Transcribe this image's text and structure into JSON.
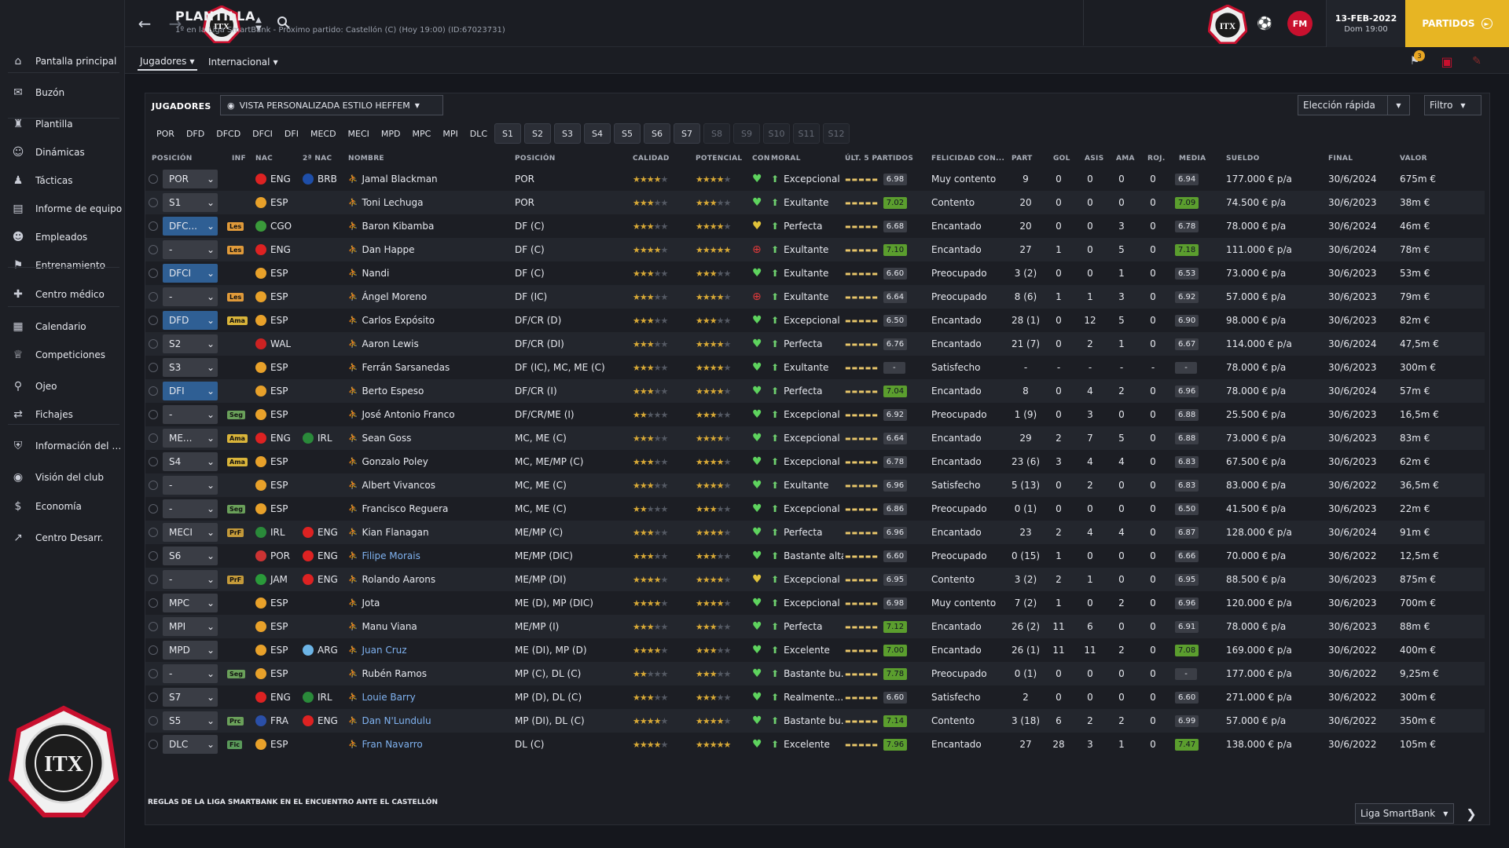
{
  "header": {
    "title": "PLANTILLA",
    "subtitle": "1º en la Liga SmartBank - Próximo partido: Castellón (C)  (Hoy 19:00) (ID:67023731)",
    "date": "13-FEB-2022",
    "date_sub": "Dom 19:00",
    "partidos": "PARTIDOS",
    "notif_count": "3",
    "fm_logo": "FM"
  },
  "sidebar": {
    "items": [
      {
        "label": "Pantalla principal",
        "icon": "home-icon"
      },
      {
        "label": "Buzón",
        "icon": "inbox-icon"
      },
      {
        "label": "Plantilla",
        "icon": "shirt-icon"
      },
      {
        "label": "Dinámicas",
        "icon": "people-icon"
      },
      {
        "label": "Tácticas",
        "icon": "tactics-icon"
      },
      {
        "label": "Informe de equipo",
        "icon": "report-icon"
      },
      {
        "label": "Empleados",
        "icon": "staff-icon"
      },
      {
        "label": "Entrenamiento",
        "icon": "training-icon"
      },
      {
        "label": "Centro médico",
        "icon": "medical-icon"
      },
      {
        "label": "Calendario",
        "icon": "calendar-icon"
      },
      {
        "label": "Competiciones",
        "icon": "trophy-icon"
      },
      {
        "label": "Ojeo",
        "icon": "scout-icon"
      },
      {
        "label": "Fichajes",
        "icon": "transfers-icon"
      },
      {
        "label": "Información del club",
        "icon": "shield-icon"
      },
      {
        "label": "Visión del club",
        "icon": "vision-icon"
      },
      {
        "label": "Economía",
        "icon": "money-icon"
      },
      {
        "label": "Centro Desarr.",
        "icon": "development-icon"
      }
    ]
  },
  "subtabs": [
    "Jugadores",
    "Internacional"
  ],
  "panel": {
    "title": "JUGADORES",
    "view": "VISTA PERSONALIZADA ESTILO HEFFEM",
    "quick": "Elección rápida",
    "filter": "Filtro",
    "footer_note": "REGLAS DE LA LIGA SMARTBANK EN EL ENCUENTRO ANTE EL CASTELLÓN",
    "league": "Liga SmartBank"
  },
  "pos_tabs": [
    "POR",
    "DFD",
    "DFCD",
    "DFCI",
    "DFI",
    "MECD",
    "MECI",
    "MPD",
    "MPC",
    "MPI",
    "DLC"
  ],
  "set_tabs": [
    {
      "label": "S1",
      "active": true
    },
    {
      "label": "S2",
      "active": true
    },
    {
      "label": "S3",
      "active": true
    },
    {
      "label": "S4",
      "active": true
    },
    {
      "label": "S5",
      "active": true
    },
    {
      "label": "S6",
      "active": true
    },
    {
      "label": "S7",
      "active": true
    },
    {
      "label": "S8",
      "active": false
    },
    {
      "label": "S9",
      "active": false
    },
    {
      "label": "S10",
      "active": false
    },
    {
      "label": "S11",
      "active": false
    },
    {
      "label": "S12",
      "active": false
    }
  ],
  "columns": [
    "POSICIÓN",
    "INF",
    "NAC",
    "2ª NAC",
    "NOMBRE",
    "POSICIÓN",
    "CALIDAD",
    "POTENCIAL",
    "CON",
    "MORAL",
    "ÚLT. 5 PARTIDOS",
    "FELICIDAD CON...",
    "PART",
    "GOL",
    "ASIS",
    "AMA",
    "ROJ.",
    "MEDIA",
    "SUELDO",
    "FINAL",
    "VALOR"
  ],
  "players": [
    {
      "sel": "POR",
      "inf": "",
      "nac": "ENG",
      "nac2": "BRB",
      "name": "Jamal Blackman",
      "pos": "POR",
      "cal": 3.5,
      "pot": 3.5,
      "con": "heart",
      "moral": "Excepcional",
      "l5": "6.98",
      "fel": "Muy contento",
      "part": "9",
      "gol": "0",
      "asis": "0",
      "ama": "0",
      "roj": "0",
      "media": "6.94",
      "sueldo": "177.000 € p/a",
      "final": "30/6/2024",
      "valor": "675m €",
      "link": false
    },
    {
      "sel": "S1",
      "inf": "",
      "nac": "ESP",
      "nac2": "",
      "name": "Toni Lechuga",
      "pos": "POR",
      "cal": 2.5,
      "pot": 2.5,
      "con": "heart",
      "moral": "Exultante",
      "l5": "7.02",
      "fel": "Contento",
      "part": "20",
      "gol": "0",
      "asis": "0",
      "ama": "0",
      "roj": "0",
      "media": "7.09",
      "sueldo": "74.500 € p/a",
      "final": "30/6/2023",
      "valor": "38m €",
      "link": false
    },
    {
      "sel": "DFC...",
      "inf": "Les",
      "nac": "CGO",
      "nac2": "",
      "name": "Baron Kibamba",
      "pos": "DF (C)",
      "cal": 3,
      "pot": 4,
      "con": "heart-y",
      "moral": "Perfecta",
      "l5": "6.68",
      "fel": "Encantado",
      "part": "20",
      "gol": "0",
      "asis": "0",
      "ama": "3",
      "roj": "0",
      "media": "6.78",
      "sueldo": "78.000 € p/a",
      "final": "30/6/2024",
      "valor": "46m €",
      "link": false
    },
    {
      "sel": "-",
      "inf": "Les",
      "nac": "ENG",
      "nac2": "",
      "name": "Dan Happe",
      "pos": "DF (C)",
      "cal": 3.5,
      "pot": 4.5,
      "con": "cross",
      "moral": "Exultante",
      "l5": "7.10",
      "fel": "Encantado",
      "part": "27",
      "gol": "1",
      "asis": "0",
      "ama": "5",
      "roj": "0",
      "media": "7.18",
      "sueldo": "111.000 € p/a",
      "final": "30/6/2024",
      "valor": "78m €",
      "link": false
    },
    {
      "sel": "DFCI",
      "inf": "",
      "nac": "ESP",
      "nac2": "",
      "name": "Nandi",
      "pos": "DF (C)",
      "cal": 2.5,
      "pot": 2.5,
      "con": "heart",
      "moral": "Exultante",
      "l5": "6.60",
      "fel": "Preocupado",
      "part": "3 (2)",
      "gol": "0",
      "asis": "0",
      "ama": "1",
      "roj": "0",
      "media": "6.53",
      "sueldo": "73.000 € p/a",
      "final": "30/6/2023",
      "valor": "53m €",
      "link": false
    },
    {
      "sel": "-",
      "inf": "Les",
      "nac": "ESP",
      "nac2": "",
      "name": "Ángel Moreno",
      "pos": "DF (IC)",
      "cal": 2.5,
      "pot": 3.5,
      "con": "cross",
      "moral": "Exultante",
      "l5": "6.64",
      "fel": "Preocupado",
      "part": "8 (6)",
      "gol": "1",
      "asis": "1",
      "ama": "3",
      "roj": "0",
      "media": "6.92",
      "sueldo": "57.000 € p/a",
      "final": "30/6/2023",
      "valor": "79m €",
      "link": false
    },
    {
      "sel": "DFD",
      "inf": "Ama",
      "nac": "ESP",
      "nac2": "",
      "name": "Carlos Expósito",
      "pos": "DF/CR (D)",
      "cal": 2.5,
      "pot": 2.5,
      "con": "heart",
      "moral": "Excepcional",
      "l5": "6.50",
      "fel": "Encantado",
      "part": "28 (1)",
      "gol": "0",
      "asis": "12",
      "ama": "5",
      "roj": "0",
      "media": "6.90",
      "sueldo": "98.000 € p/a",
      "final": "30/6/2023",
      "valor": "82m €",
      "link": false
    },
    {
      "sel": "S2",
      "inf": "",
      "nac": "WAL",
      "nac2": "",
      "name": "Aaron Lewis",
      "pos": "DF/CR (DI)",
      "cal": 2.5,
      "pot": 3.5,
      "con": "heart",
      "moral": "Perfecta",
      "l5": "6.76",
      "fel": "Encantado",
      "part": "21 (7)",
      "gol": "0",
      "asis": "2",
      "ama": "1",
      "roj": "0",
      "media": "6.67",
      "sueldo": "114.000 € p/a",
      "final": "30/6/2024",
      "valor": "47,5m €",
      "link": false
    },
    {
      "sel": "S3",
      "inf": "",
      "nac": "ESP",
      "nac2": "",
      "name": "Ferrán Sarsanedas",
      "pos": "DF (IC), MC, ME (C)",
      "cal": 3,
      "pot": 3.5,
      "con": "heart",
      "moral": "Exultante",
      "l5": "-",
      "fel": "Satisfecho",
      "part": "-",
      "gol": "-",
      "asis": "-",
      "ama": "-",
      "roj": "-",
      "media": "-",
      "sueldo": "78.000 € p/a",
      "final": "30/6/2023",
      "valor": "300m €",
      "link": false
    },
    {
      "sel": "DFI",
      "inf": "",
      "nac": "ESP",
      "nac2": "",
      "name": "Berto Espeso",
      "pos": "DF/CR (I)",
      "cal": 3,
      "pot": 4,
      "con": "heart",
      "moral": "Perfecta",
      "l5": "7.04",
      "fel": "Encantado",
      "part": "8",
      "gol": "0",
      "asis": "4",
      "ama": "2",
      "roj": "0",
      "media": "6.96",
      "sueldo": "78.000 € p/a",
      "final": "30/6/2024",
      "valor": "57m €",
      "link": false
    },
    {
      "sel": "-",
      "inf": "Seg",
      "nac": "ESP",
      "nac2": "",
      "name": "José Antonio Franco",
      "pos": "DF/CR/ME (I)",
      "cal": 2,
      "pot": 3,
      "con": "heart",
      "moral": "Excepcional",
      "l5": "6.92",
      "fel": "Preocupado",
      "part": "1 (9)",
      "gol": "0",
      "asis": "3",
      "ama": "0",
      "roj": "0",
      "media": "6.88",
      "sueldo": "25.500 € p/a",
      "final": "30/6/2023",
      "valor": "16,5m €",
      "link": false
    },
    {
      "sel": "ME...",
      "inf": "Ama",
      "nac": "ENG",
      "nac2": "IRL",
      "name": "Sean Goss",
      "pos": "MC, ME (C)",
      "cal": 3,
      "pot": 3.5,
      "con": "heart",
      "moral": "Excepcional",
      "l5": "6.64",
      "fel": "Encantado",
      "part": "29",
      "gol": "2",
      "asis": "7",
      "ama": "5",
      "roj": "0",
      "media": "6.88",
      "sueldo": "73.000 € p/a",
      "final": "30/6/2023",
      "valor": "83m €",
      "link": false
    },
    {
      "sel": "S4",
      "inf": "Ama",
      "nac": "ESP",
      "nac2": "",
      "name": "Gonzalo Poley",
      "pos": "MC, ME/MP (C)",
      "cal": 2.5,
      "pot": 3.5,
      "con": "heart",
      "moral": "Excepcional",
      "l5": "6.78",
      "fel": "Encantado",
      "part": "23 (6)",
      "gol": "3",
      "asis": "4",
      "ama": "4",
      "roj": "0",
      "media": "6.83",
      "sueldo": "67.500 € p/a",
      "final": "30/6/2023",
      "valor": "62m €",
      "link": false
    },
    {
      "sel": "-",
      "inf": "",
      "nac": "ESP",
      "nac2": "",
      "name": "Albert Vivancos",
      "pos": "MC, ME (C)",
      "cal": 3,
      "pot": 3.5,
      "con": "heart",
      "moral": "Exultante",
      "l5": "6.96",
      "fel": "Satisfecho",
      "part": "5 (13)",
      "gol": "0",
      "asis": "2",
      "ama": "0",
      "roj": "0",
      "media": "6.83",
      "sueldo": "83.000 € p/a",
      "final": "30/6/2022",
      "valor": "36,5m €",
      "link": false
    },
    {
      "sel": "-",
      "inf": "Seg",
      "nac": "ESP",
      "nac2": "",
      "name": "Francisco Reguera",
      "pos": "MC, ME (C)",
      "cal": 2,
      "pot": 3,
      "con": "heart",
      "moral": "Excepcional",
      "l5": "6.86",
      "fel": "Preocupado",
      "part": "0 (1)",
      "gol": "0",
      "asis": "0",
      "ama": "0",
      "roj": "0",
      "media": "6.50",
      "sueldo": "41.500 € p/a",
      "final": "30/6/2023",
      "valor": "22m €",
      "link": false
    },
    {
      "sel": "MECI",
      "inf": "PrF",
      "nac": "IRL",
      "nac2": "ENG",
      "name": "Kian Flanagan",
      "pos": "ME/MP (C)",
      "cal": 3,
      "pot": 4,
      "con": "heart",
      "moral": "Perfecta",
      "l5": "6.96",
      "fel": "Encantado",
      "part": "23",
      "gol": "2",
      "asis": "4",
      "ama": "4",
      "roj": "0",
      "media": "6.87",
      "sueldo": "128.000 € p/a",
      "final": "30/6/2024",
      "valor": "91m €",
      "link": false
    },
    {
      "sel": "S6",
      "inf": "",
      "nac": "POR",
      "nac2": "ENG",
      "name": "Filipe Morais",
      "pos": "ME/MP (DIC)",
      "cal": 3,
      "pot": 3,
      "con": "heart",
      "moral": "Bastante alta",
      "l5": "6.60",
      "fel": "Preocupado",
      "part": "0 (15)",
      "gol": "1",
      "asis": "0",
      "ama": "0",
      "roj": "0",
      "media": "6.66",
      "sueldo": "70.000 € p/a",
      "final": "30/6/2022",
      "valor": "12,5m €",
      "link": true
    },
    {
      "sel": "-",
      "inf": "PrF",
      "nac": "JAM",
      "nac2": "ENG",
      "name": "Rolando Aarons",
      "pos": "ME/MP (DI)",
      "cal": 3.5,
      "pot": 3.5,
      "con": "heart-y",
      "moral": "Excepcional",
      "l5": "6.95",
      "fel": "Contento",
      "part": "3 (2)",
      "gol": "2",
      "asis": "1",
      "ama": "0",
      "roj": "0",
      "media": "6.95",
      "sueldo": "88.500 € p/a",
      "final": "30/6/2023",
      "valor": "875m €",
      "link": false
    },
    {
      "sel": "MPC",
      "inf": "",
      "nac": "ESP",
      "nac2": "",
      "name": "Jota",
      "pos": "ME (D), MP (DIC)",
      "cal": 3.5,
      "pot": 3.5,
      "con": "heart",
      "moral": "Excepcional",
      "l5": "6.98",
      "fel": "Muy contento",
      "part": "7 (2)",
      "gol": "1",
      "asis": "0",
      "ama": "2",
      "roj": "0",
      "media": "6.96",
      "sueldo": "120.000 € p/a",
      "final": "30/6/2023",
      "valor": "700m €",
      "link": false
    },
    {
      "sel": "MPI",
      "inf": "",
      "nac": "ESP",
      "nac2": "",
      "name": "Manu Viana",
      "pos": "ME/MP (I)",
      "cal": 2.5,
      "pot": 3,
      "con": "heart",
      "moral": "Perfecta",
      "l5": "7.12",
      "fel": "Encantado",
      "part": "26 (2)",
      "gol": "11",
      "asis": "6",
      "ama": "0",
      "roj": "0",
      "media": "6.91",
      "sueldo": "78.000 € p/a",
      "final": "30/6/2023",
      "valor": "88m €",
      "link": false
    },
    {
      "sel": "MPD",
      "inf": "",
      "nac": "ESP",
      "nac2": "ARG",
      "name": "Juan Cruz",
      "pos": "ME (DI), MP (D)",
      "cal": 3.5,
      "pot": 3,
      "con": "heart",
      "moral": "Excelente",
      "l5": "7.00",
      "fel": "Encantado",
      "part": "26 (1)",
      "gol": "11",
      "asis": "11",
      "ama": "2",
      "roj": "0",
      "media": "7.08",
      "sueldo": "169.000 € p/a",
      "final": "30/6/2022",
      "valor": "400m €",
      "link": true
    },
    {
      "sel": "-",
      "inf": "Seg",
      "nac": "ESP",
      "nac2": "",
      "name": "Rubén Ramos",
      "pos": "MP (C), DL (C)",
      "cal": 2,
      "pot": 2.5,
      "con": "heart",
      "moral": "Bastante bu...",
      "l5": "7.78",
      "fel": "Preocupado",
      "part": "0 (1)",
      "gol": "0",
      "asis": "0",
      "ama": "0",
      "roj": "0",
      "media": "-",
      "sueldo": "177.000 € p/a",
      "final": "30/6/2022",
      "valor": "9,25m €",
      "link": false
    },
    {
      "sel": "S7",
      "inf": "",
      "nac": "ENG",
      "nac2": "IRL",
      "name": "Louie Barry",
      "pos": "MP (D), DL (C)",
      "cal": 3,
      "pot": 3,
      "con": "heart",
      "moral": "Realmente...",
      "l5": "6.60",
      "fel": "Satisfecho",
      "part": "2",
      "gol": "0",
      "asis": "0",
      "ama": "0",
      "roj": "0",
      "media": "6.60",
      "sueldo": "271.000 € p/a",
      "final": "30/6/2022",
      "valor": "300m €",
      "link": true
    },
    {
      "sel": "S5",
      "inf": "Prc",
      "nac": "FRA",
      "nac2": "ENG",
      "name": "Dan N'Lundulu",
      "pos": "MP (DI), DL (C)",
      "cal": 3.5,
      "pot": 3.5,
      "con": "heart",
      "moral": "Bastante bu...",
      "l5": "7.14",
      "fel": "Contento",
      "part": "3 (18)",
      "gol": "6",
      "asis": "2",
      "ama": "2",
      "roj": "0",
      "media": "6.99",
      "sueldo": "57.000 € p/a",
      "final": "30/6/2022",
      "valor": "350m €",
      "link": true
    },
    {
      "sel": "DLC",
      "inf": "Fic",
      "nac": "ESP",
      "nac2": "",
      "name": "Fran Navarro",
      "pos": "DL (C)",
      "cal": 3.5,
      "pot": 4.5,
      "con": "heart",
      "moral": "Excelente",
      "l5": "7.96",
      "fel": "Encantado",
      "part": "27",
      "gol": "28",
      "asis": "3",
      "ama": "1",
      "roj": "0",
      "media": "7.47",
      "sueldo": "138.000 € p/a",
      "final": "30/6/2022",
      "valor": "105m €",
      "link": true
    }
  ]
}
